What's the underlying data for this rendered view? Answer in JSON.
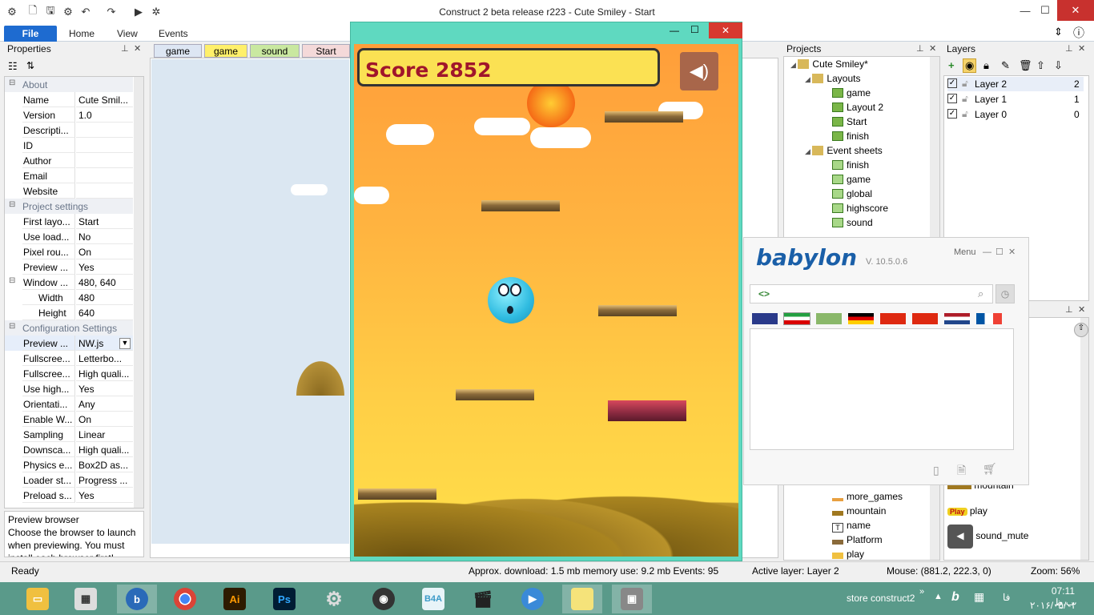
{
  "window": {
    "title": "Construct 2 beta release r223 - Cute Smiley - Start",
    "min": "—",
    "max": "☐",
    "close": "✕"
  },
  "ribbon": {
    "tabs": [
      "File",
      "Home",
      "View",
      "Events"
    ]
  },
  "properties": {
    "title": "Properties",
    "sections": {
      "about": "About",
      "project": "Project settings",
      "config": "Configuration Settings"
    },
    "rows": [
      {
        "k": "Name",
        "v": "Cute Smil..."
      },
      {
        "k": "Version",
        "v": "1.0"
      },
      {
        "k": "Descripti...",
        "v": ""
      },
      {
        "k": "ID",
        "v": ""
      },
      {
        "k": "Author",
        "v": ""
      },
      {
        "k": "Email",
        "v": ""
      },
      {
        "k": "Website",
        "v": ""
      },
      {
        "k": "First layo...",
        "v": "Start"
      },
      {
        "k": "Use load...",
        "v": "No"
      },
      {
        "k": "Pixel rou...",
        "v": "On"
      },
      {
        "k": "Preview ...",
        "v": "Yes"
      },
      {
        "k": "Window ...",
        "v": "480, 640"
      },
      {
        "k": "Width",
        "v": "480"
      },
      {
        "k": "Height",
        "v": "640"
      },
      {
        "k": "Preview ...",
        "v": "NW.js"
      },
      {
        "k": "Fullscree...",
        "v": "Letterbo..."
      },
      {
        "k": "Fullscree...",
        "v": "High quali..."
      },
      {
        "k": "Use high...",
        "v": "Yes"
      },
      {
        "k": "Orientati...",
        "v": "Any"
      },
      {
        "k": "Enable W...",
        "v": "On"
      },
      {
        "k": "Sampling",
        "v": "Linear"
      },
      {
        "k": "Downsca...",
        "v": "High quali..."
      },
      {
        "k": "Physics e...",
        "v": "Box2D as..."
      },
      {
        "k": "Loader st...",
        "v": "Progress ..."
      },
      {
        "k": "Preload s...",
        "v": "Yes"
      }
    ],
    "help_title": "Preview browser",
    "help_text": "Choose the browser to launch when previewing.  You must install each browser first!"
  },
  "doc_tabs": [
    "game",
    "game",
    "sound",
    "Start"
  ],
  "game": {
    "score_label": "Score 2852",
    "sound_icon": "speaker-icon"
  },
  "projects": {
    "title": "Projects",
    "items": [
      {
        "label": "Cute Smiley*"
      },
      {
        "label": "Layouts"
      },
      {
        "label": "game"
      },
      {
        "label": "Layout 2"
      },
      {
        "label": "Start"
      },
      {
        "label": "finish"
      },
      {
        "label": "Event sheets"
      },
      {
        "label": "finish"
      },
      {
        "label": "game"
      },
      {
        "label": "global"
      },
      {
        "label": "highscore"
      },
      {
        "label": "sound"
      }
    ],
    "lower_items": [
      "more_games",
      "mountain",
      "name",
      "Platform",
      "play"
    ]
  },
  "layers": {
    "title": "Layers",
    "rows": [
      {
        "name": "Layer 2",
        "num": "2"
      },
      {
        "name": "Layer 1",
        "num": "1"
      },
      {
        "name": "Layer 0",
        "num": "0"
      }
    ]
  },
  "objects": {
    "items": [
      "mountain",
      "play",
      "sound_mute"
    ],
    "play_badge": "Play",
    "partial": "o"
  },
  "babylon": {
    "logo": "babylon",
    "version": "V. 10.5.0.6",
    "menu": "Menu",
    "input_icon": "<>"
  },
  "status": {
    "ready": "Ready",
    "download": "Approx. download: 1.5 mb  memory use: 9.2 mb  Events: 95",
    "layer": "Active layer: Layer 2",
    "mouse": "Mouse: (881.2, 222.3, 0)",
    "zoom": "Zoom: 56%"
  },
  "taskbar": {
    "tray_label": "store construct2",
    "lang": "فا",
    "time": "07:11 ب.ظ",
    "date": "۲۰۱۶/۰۵/۰۲",
    "apps": [
      "Ai",
      "Ps",
      "B4A"
    ]
  },
  "colors": {
    "accent": "#1e6bd0",
    "score_text": "#a0152b",
    "game_window": "#5fd9c0"
  }
}
